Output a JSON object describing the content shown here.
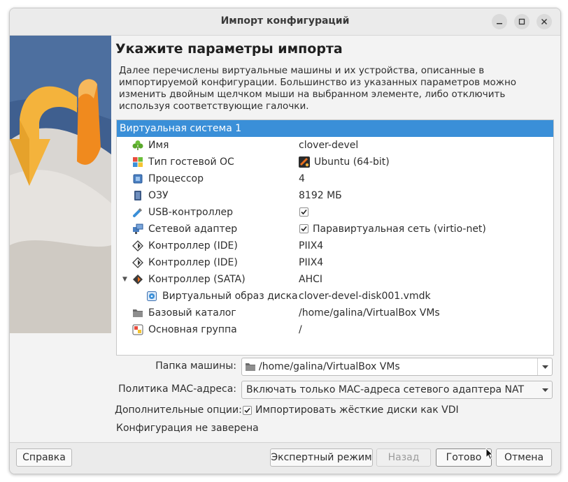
{
  "window": {
    "title": "Импорт конфигураций",
    "controls": {
      "minimize": "–",
      "maximize": "□",
      "close": "×"
    }
  },
  "heading": "Укажите параметры импорта",
  "description": "Далее перечислены виртуальные машины и их устройства, описанные в импортируемой конфигурации. Большинство из указанных параметров можно изменить двойным щелчком мыши на выбранном элементе, либо отключить используя соответствующие галочки.",
  "tree": {
    "header": "Виртуальная система 1",
    "rows": [
      {
        "label": "Имя",
        "value": "clover-devel",
        "icon": "name-icon"
      },
      {
        "label": "Тип гостевой ОС",
        "value": "Ubuntu (64-bit)",
        "icon": "os-type-icon"
      },
      {
        "label": "Процессор",
        "value": "4",
        "icon": "cpu-icon"
      },
      {
        "label": "ОЗУ",
        "value": "8192 МБ",
        "icon": "ram-icon"
      },
      {
        "label": "USB-контроллер",
        "value": "",
        "checked": true,
        "icon": "usb-icon"
      },
      {
        "label": "Сетевой адаптер",
        "value": "Паравиртуальная сеть (virtio-net)",
        "checked": true,
        "icon": "network-icon"
      },
      {
        "label": "Контроллер (IDE)",
        "value": "PIIX4",
        "icon": "ide-icon"
      },
      {
        "label": "Контроллер (IDE)",
        "value": "PIIX4",
        "icon": "ide-icon"
      },
      {
        "label": "Контроллер (SATA)",
        "value": "AHCI",
        "icon": "sata-icon",
        "expanded": true
      },
      {
        "label": "Виртуальный образ диска",
        "value": "clover-devel-disk001.vmdk",
        "icon": "disk-image-icon"
      },
      {
        "label": "Базовый каталог",
        "value": "/home/galina/VirtualBox VMs",
        "icon": "folder-icon"
      },
      {
        "label": "Основная группа",
        "value": "/",
        "icon": "group-icon"
      }
    ]
  },
  "form": {
    "machine_folder_label": "Папка машины:",
    "machine_folder_value": "/home/galina/VirtualBox VMs",
    "mac_policy_label": "Политика MAC-адреса:",
    "mac_policy_value": "Включать только MAC-адреса сетевого адаптера NAT",
    "extra_options_label": "Дополнительные опции:",
    "import_vdi_label": "Импортировать жёсткие диски как VDI",
    "import_vdi_checked": true,
    "signature_status": "Конфигурация не заверена"
  },
  "buttons": {
    "help": "Справка",
    "expert": "Экспертный режим",
    "back": "Назад",
    "finish": "Готово",
    "cancel": "Отмена"
  },
  "colors": {
    "selection": "#3a8fd8",
    "banner_sky": "#3f5f8f",
    "banner_arrow": "#f4b33c"
  }
}
